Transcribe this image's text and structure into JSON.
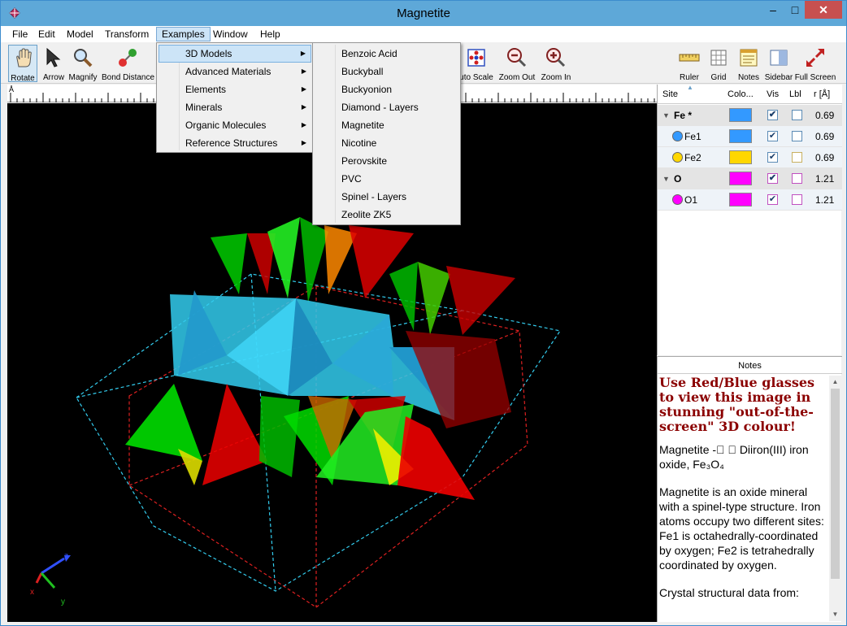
{
  "window": {
    "title": "Magnetite"
  },
  "menubar": {
    "items": [
      "File",
      "Edit",
      "Model",
      "Transform",
      "Examples",
      "Window",
      "Help"
    ]
  },
  "examples_menu": {
    "items": [
      {
        "label": "3D Models"
      },
      {
        "label": "Advanced Materials"
      },
      {
        "label": "Elements"
      },
      {
        "label": "Minerals"
      },
      {
        "label": "Organic Molecules"
      },
      {
        "label": "Reference Structures"
      }
    ]
  },
  "models_submenu": {
    "items": [
      "Benzoic Acid",
      "Buckyball",
      "Buckyonion",
      "Diamond - Layers",
      "Magnetite",
      "Nicotine",
      "Perovskite",
      "PVC",
      "Spinel - Layers",
      "Zeolite ZK5"
    ]
  },
  "toolbar": {
    "left": [
      {
        "label": "Rotate",
        "icon": "hand-icon"
      },
      {
        "label": "Arrow",
        "icon": "arrow-cursor-icon"
      },
      {
        "label": "Magnify",
        "icon": "magnifier-icon"
      },
      {
        "label": "Bond Distance",
        "icon": "bond-distance-icon"
      }
    ],
    "right": [
      {
        "label": "uto Scale",
        "icon": "auto-scale-icon"
      },
      {
        "label": "Zoom Out",
        "icon": "zoom-out-icon"
      },
      {
        "label": "Zoom In",
        "icon": "zoom-in-icon"
      },
      {
        "label": "Ruler",
        "icon": "ruler-icon"
      },
      {
        "label": "Grid",
        "icon": "grid-icon"
      },
      {
        "label": "Notes",
        "icon": "notes-icon"
      },
      {
        "label": "Sidebar",
        "icon": "sidebar-icon"
      },
      {
        "label": "Full Screen",
        "icon": "full-screen-icon"
      }
    ]
  },
  "ruler": {
    "unit": "Å"
  },
  "sites_table": {
    "headers": {
      "site": "Site",
      "color": "Colo...",
      "vis": "Vis",
      "lbl": "Lbl",
      "r": "r [Å]"
    },
    "rows": [
      {
        "type": "group",
        "site": "Fe  *",
        "color": "#3399ff",
        "vis": true,
        "lbl": false,
        "r": "0.69"
      },
      {
        "type": "site",
        "site": "Fe1",
        "color": "#3399ff",
        "vis": true,
        "lbl": false,
        "r": "0.69"
      },
      {
        "type": "site",
        "site": "Fe2",
        "color": "#ffd700",
        "vis": true,
        "lbl": false,
        "r": "0.69"
      },
      {
        "type": "group",
        "site": "O",
        "color": "#ff00ff",
        "vis": true,
        "lbl": false,
        "r": "1.21"
      },
      {
        "type": "site",
        "site": "O1",
        "color": "#ff00ff",
        "vis": true,
        "lbl": false,
        "r": "1.21"
      }
    ]
  },
  "notes": {
    "header": "Notes",
    "heading": "Use Red/Blue glasses to view this image in stunning \"out-of-the-screen\" 3D colour!",
    "paragraphs": [
      "Magnetite -⃟ ⃟ Diiron(III) iron oxide, Fe₃O₄",
      "Magnetite is an oxide mineral with a spinel-type structure. Iron atoms occupy two different sites: Fe1 is octahedrally-coordinated by oxygen; Fe2 is tetrahedrally coordinated by oxygen.",
      "Crystal structural data from:"
    ]
  },
  "axes": {
    "x": "x",
    "y": "y",
    "z": "z"
  },
  "colors": {
    "accent": "#5ea8d8",
    "anaglyph_red": "#e00000",
    "anaglyph_green": "#00dd00",
    "anaglyph_cyan": "#33ccee",
    "heading": "#8b0000"
  }
}
